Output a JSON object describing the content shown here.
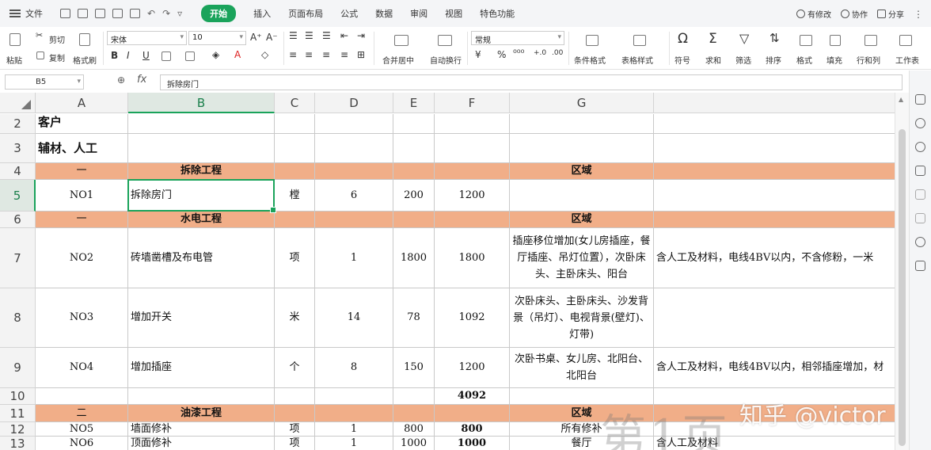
{
  "menu": {
    "file_label": "文件",
    "tabs": [
      "开始",
      "插入",
      "页面布局",
      "公式",
      "数据",
      "审阅",
      "视图",
      "特色功能"
    ],
    "active_tab": "开始",
    "right": {
      "edits": "有修改",
      "collab": "协作",
      "share": "分享",
      "more": "⋮"
    }
  },
  "toolbar": {
    "paste": "粘贴",
    "cut": "剪切",
    "copy": "复制",
    "format_painter": "格式刷",
    "font_name": "宋体",
    "font_size": "10",
    "bold": "B",
    "italic": "I",
    "underline": "U",
    "merge_center": "合并居中",
    "wrap_text": "自动换行",
    "number_format": "常规",
    "currency": "¥",
    "percent": "%",
    "thousands": "⁰⁰⁰",
    "cond_format": "条件格式",
    "table_style": "表格样式",
    "symbol": "符号",
    "sum": "求和",
    "filter": "筛选",
    "sort": "排序",
    "format": "格式",
    "fill": "填充",
    "row_col": "行和列",
    "worksheet": "工作表"
  },
  "formula_bar": {
    "name_box": "B5",
    "fx": "fx",
    "content": "拆除房门"
  },
  "grid": {
    "columns": [
      "A",
      "B",
      "C",
      "D",
      "E",
      "F",
      "G"
    ],
    "active_column": "B",
    "active_row": "5",
    "rows": [
      {
        "num": "2",
        "cells": [
          "客户",
          "",
          "",
          "",
          "",
          "",
          "",
          ""
        ]
      },
      {
        "num": "3",
        "cells": [
          "辅材、人工",
          "",
          "",
          "",
          "",
          "",
          "",
          ""
        ]
      },
      {
        "num": "4",
        "cells": [
          "一",
          "拆除工程",
          "",
          "",
          "",
          "",
          "区域",
          ""
        ]
      },
      {
        "num": "5",
        "cells": [
          "NO1",
          "拆除房门",
          "樘",
          "6",
          "200",
          "1200",
          "",
          ""
        ]
      },
      {
        "num": "6",
        "cells": [
          "一",
          "水电工程",
          "",
          "",
          "",
          "",
          "区域",
          ""
        ]
      },
      {
        "num": "7",
        "cells": [
          "NO2",
          "砖墙凿槽及布电管",
          "项",
          "1",
          "1800",
          "1800",
          "插座移位增加(女儿房插座，餐厅插座、吊灯位置），次卧床头、主卧床头、阳台",
          "含人工及材料，电线4BV以内，不含修粉，一米"
        ]
      },
      {
        "num": "8",
        "cells": [
          "NO3",
          "增加开关",
          "米",
          "14",
          "78",
          "1092",
          "次卧床头、主卧床头、沙发背景（吊灯）、电视背景(壁灯)、灯带)",
          ""
        ]
      },
      {
        "num": "9",
        "cells": [
          "NO4",
          "增加插座",
          "个",
          "8",
          "150",
          "1200",
          "次卧书桌、女儿房、北阳台、北阳台",
          "含人工及材料，电线4BV以内，相邻插座增加，材"
        ]
      },
      {
        "num": "10",
        "cells": [
          "",
          "",
          "",
          "",
          "",
          "4092",
          "",
          ""
        ]
      },
      {
        "num": "11",
        "cells": [
          "二",
          "油漆工程",
          "",
          "",
          "",
          "",
          "区域",
          ""
        ]
      },
      {
        "num": "12",
        "cells": [
          "NO5",
          "墙面修补",
          "项",
          "1",
          "800",
          "800",
          "所有修补",
          ""
        ]
      },
      {
        "num": "13",
        "cells": [
          "NO6",
          "顶面修补",
          "项",
          "1",
          "1000",
          "1000",
          "餐厅",
          "含人工及材料"
        ]
      }
    ]
  },
  "watermark": {
    "text": "知乎 @victor",
    "page_text": "第1页"
  }
}
